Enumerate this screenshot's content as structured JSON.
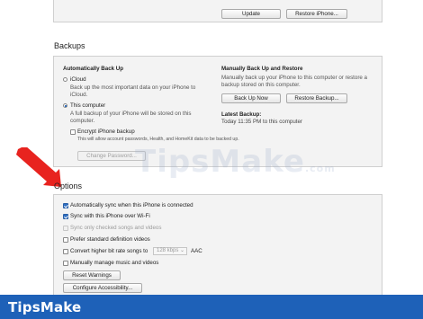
{
  "top": {
    "update_label": "Update",
    "restore_label": "Restore iPhone..."
  },
  "backups": {
    "title": "Backups",
    "auto_title": "Automatically Back Up",
    "icloud_label": "iCloud",
    "icloud_desc": "Back up the most important data on your iPhone to iCloud.",
    "computer_label": "This computer",
    "computer_desc": "A full backup of your iPhone will be stored on this computer.",
    "encrypt_label": "Encrypt iPhone backup",
    "encrypt_desc": "This will allow account passwords, Health, and HomeKit data to be backed up.",
    "change_password_label": "Change Password...",
    "manual_title": "Manually Back Up and Restore",
    "manual_desc": "Manually back up your iPhone to this computer or restore a backup stored on this computer.",
    "backup_now_label": "Back Up Now",
    "restore_backup_label": "Restore Backup...",
    "latest_title": "Latest Backup:",
    "latest_value": "Today 11:35 PM to this computer"
  },
  "options": {
    "title": "Options",
    "items": [
      {
        "label": "Automatically sync when this iPhone is connected",
        "checked": true,
        "disabled": false
      },
      {
        "label": "Sync with this iPhone over Wi-Fi",
        "checked": true,
        "disabled": false
      },
      {
        "label": "Sync only checked songs and videos",
        "checked": false,
        "disabled": true
      },
      {
        "label": "Prefer standard definition videos",
        "checked": false,
        "disabled": false
      },
      {
        "label": "Convert higher bit rate songs to",
        "checked": false,
        "disabled": false
      },
      {
        "label": "Manually manage music and videos",
        "checked": false,
        "disabled": false
      }
    ],
    "bitrate_value": "128 kbps",
    "bitrate_format": "AAC",
    "reset_warnings_label": "Reset Warnings",
    "configure_accessibility_label": "Configure Accessibility..."
  },
  "watermark": {
    "text": "TipsMake",
    "suffix": ".com"
  },
  "footer": {
    "brand": "TipsMake"
  },
  "colors": {
    "accent": "#1e61b8",
    "arrow": "#e8231f",
    "checkbox": "#2f6fc2"
  }
}
